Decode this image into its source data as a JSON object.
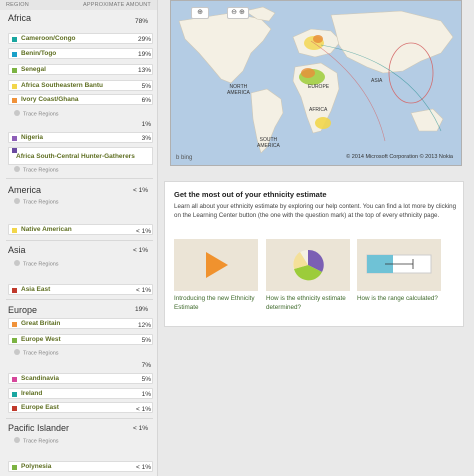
{
  "header": {
    "region_label": "REGION",
    "amount_label": "APPROXIMATE AMOUNT"
  },
  "trace_label": "Trace Regions",
  "africa": {
    "name": "Africa",
    "percent": "78%",
    "items": [
      {
        "label": "Cameroon/Congo",
        "value": "29%",
        "color": "#1aa6a0"
      },
      {
        "label": "Benin/Togo",
        "value": "19%",
        "color": "#19a0c8"
      },
      {
        "label": "Senegal",
        "value": "13%",
        "color": "#7cb342"
      },
      {
        "label": "Africa Southeastern Bantu",
        "value": "5%",
        "color": "#f2d64b"
      },
      {
        "label": "Ivory Coast/Ghana",
        "value": "6%",
        "color": "#f0923a"
      },
      {
        "label": "Nigeria",
        "value": "3%",
        "color": "#8e5fb8"
      },
      {
        "label": "Africa South-Central Hunter-Gatherers",
        "value": "",
        "color": "#6a4aa0"
      }
    ],
    "extra_value": "1%"
  },
  "america": {
    "name": "America",
    "percent": "< 1%",
    "items": [
      {
        "label": "Native American",
        "value": "< 1%",
        "color": "#f2d64b"
      }
    ]
  },
  "asia": {
    "name": "Asia",
    "percent": "< 1%",
    "items": [
      {
        "label": "Asia East",
        "value": "< 1%",
        "color": "#c0392b"
      }
    ]
  },
  "europe": {
    "name": "Europe",
    "percent": "19%",
    "items": [
      {
        "label": "Great Britain",
        "value": "12%",
        "color": "#f0923a"
      },
      {
        "label": "Europe West",
        "value": "5%",
        "color": "#7cb342"
      },
      {
        "label": "Scandinavia",
        "value": "5%",
        "color": "#d6479b"
      },
      {
        "label": "Ireland",
        "value": "1%",
        "color": "#1aa6a0"
      },
      {
        "label": "Europe East",
        "value": "< 1%",
        "color": "#c0392b"
      }
    ],
    "extra_value": "7%"
  },
  "pacific": {
    "name": "Pacific Islander",
    "percent": "< 1%",
    "items": [
      {
        "label": "Polynesia",
        "value": "< 1%",
        "color": "#7cb342"
      }
    ]
  },
  "map": {
    "labels": {
      "north_america": "NORTH\nAMERICA",
      "europe": "EUROPE",
      "asia": "ASIA",
      "africa": "AFRICA",
      "south_america": "SOUTH\nAMERICA"
    },
    "copyright": "© 2014 Microsoft Corporation  © 2013 Nokia",
    "bing": "b bing"
  },
  "card": {
    "title": "Get the most out of your ethnicity estimate",
    "desc": "Learn all about your ethnicity estimate by exploring our help content. You can find a lot more by clicking on the Learning Center button (the one with the question mark) at the top of every ethnicity page.",
    "tiles": [
      {
        "caption": "Introducing the new Ethnicity Estimate"
      },
      {
        "caption": "How is the ethnicity estimate determined?"
      },
      {
        "caption": "How is the range calculated?"
      }
    ]
  }
}
